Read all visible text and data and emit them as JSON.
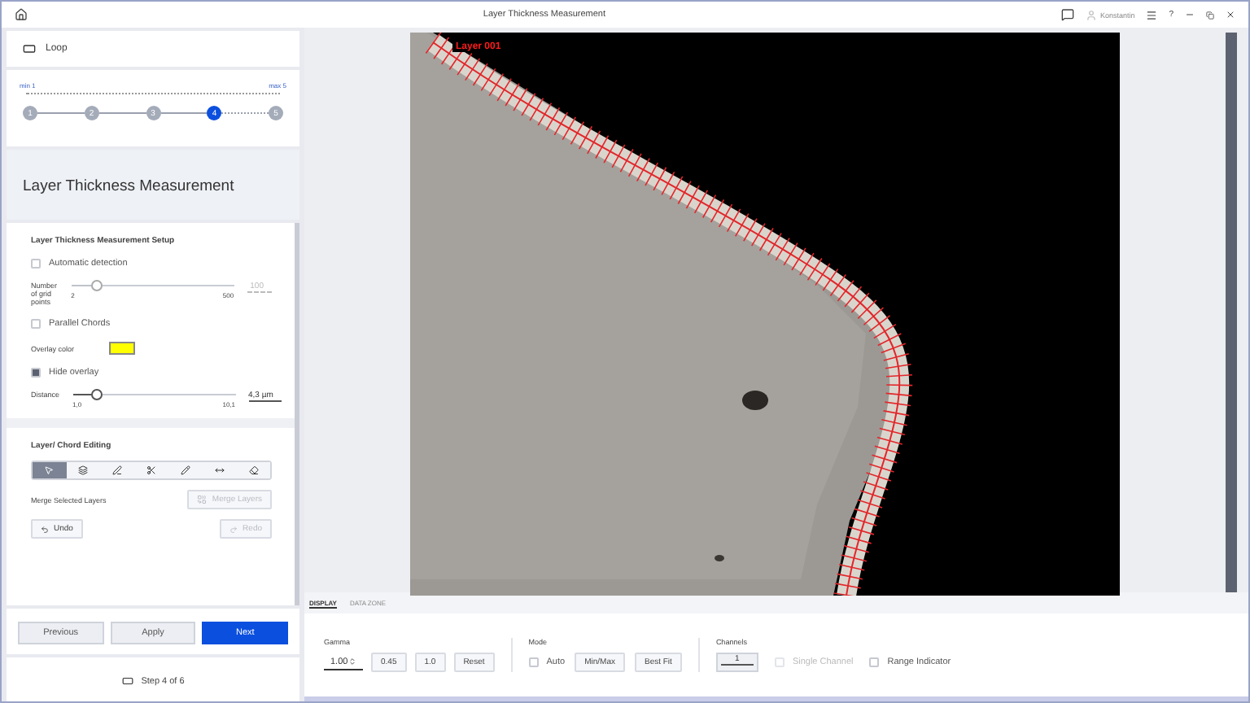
{
  "window": {
    "title": "Layer Thickness Measurement",
    "user": "Konstantin",
    "help": "?"
  },
  "loop": {
    "label": "Loop",
    "min": "min 1",
    "max": "max 5",
    "steps": [
      {
        "label": "1",
        "selected": false
      },
      {
        "label": "2",
        "selected": false
      },
      {
        "label": "3",
        "selected": false
      },
      {
        "label": "4",
        "selected": true
      },
      {
        "label": "5",
        "selected": false
      }
    ]
  },
  "panel_title": "Layer Thickness Measurement",
  "setup": {
    "title": "Layer Thickness Measurement Setup",
    "automatic_detection": {
      "label": "Automatic detection",
      "checked": false
    },
    "grid_points": {
      "label": "Number of grid points",
      "min": "2",
      "max": "500",
      "value": "100",
      "level": 0.15,
      "disabled": true
    },
    "parallel_chords": {
      "label": "Parallel Chords",
      "checked": false
    },
    "overlay_color": {
      "label": "Overlay color",
      "color": "#ffff00"
    },
    "hide_overlay": {
      "label": "Hide overlay",
      "checked": true
    },
    "distance": {
      "label": "Distance",
      "min": "1,0",
      "max": "10,1",
      "value": "4,3 µm",
      "level": 0.14,
      "disabled": false
    }
  },
  "editing": {
    "title": "Layer/ Chord Editing",
    "tools": [
      {
        "kind": "pointer",
        "selected": true
      },
      {
        "kind": "add-layer",
        "selected": false
      },
      {
        "kind": "edit-layer",
        "selected": false
      },
      {
        "kind": "cut",
        "selected": false
      },
      {
        "kind": "pen",
        "selected": false
      },
      {
        "kind": "measure",
        "selected": false
      },
      {
        "kind": "eraser",
        "selected": false
      }
    ],
    "merge_label": "Merge Selected Layers",
    "merge_button": {
      "label": "Merge Layers",
      "disabled": true
    },
    "undo": {
      "label": "Undo",
      "disabled": false
    },
    "redo": {
      "label": "Redo",
      "disabled": true
    }
  },
  "nav_buttons": [
    {
      "label": "Previous",
      "primary": false
    },
    {
      "label": "Apply",
      "primary": false
    },
    {
      "label": "Next",
      "primary": true
    }
  ],
  "step_status": "Step 4 of 6",
  "image": {
    "layer_label": "Layer 001"
  },
  "bottom_tabs": [
    {
      "label": "DISPLAY",
      "selected": true
    },
    {
      "label": "DATA ZONE",
      "selected": false
    }
  ],
  "gamma": {
    "title": "Gamma",
    "value": "1.00",
    "buttons": [
      "0.45",
      "1.0",
      "Reset"
    ]
  },
  "mode": {
    "title": "Mode",
    "auto": {
      "label": "Auto",
      "checked": false
    },
    "buttons": [
      "Min/Max",
      "Best Fit"
    ]
  },
  "channels": {
    "title": "Channels",
    "value": "1",
    "level": 1,
    "options": [
      {
        "label": "Single Channel",
        "checked": false,
        "disabled": true
      },
      {
        "label": "Range Indicator",
        "checked": false,
        "disabled": false
      }
    ]
  }
}
